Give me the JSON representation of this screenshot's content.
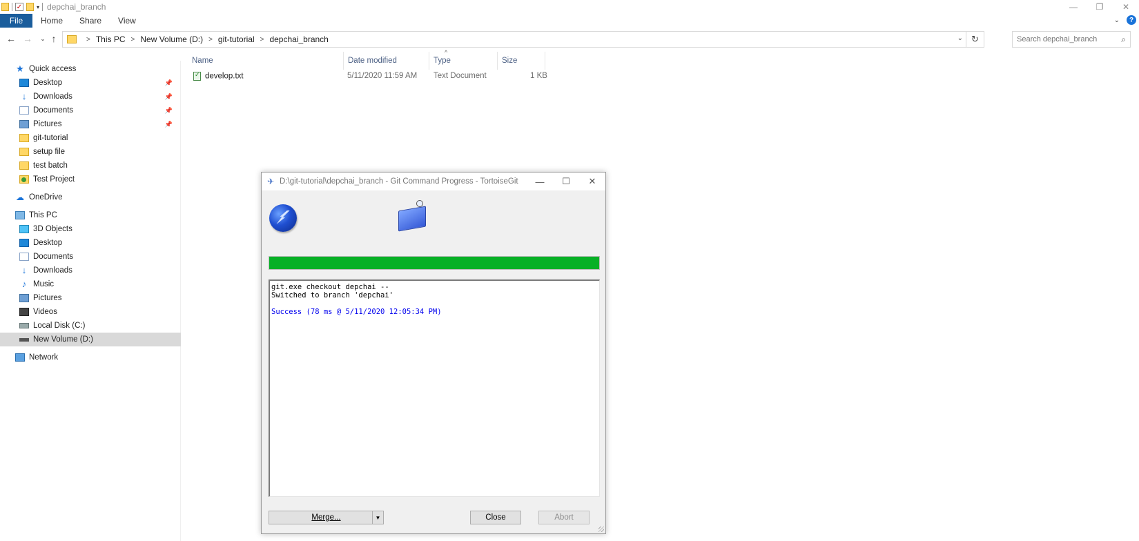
{
  "window": {
    "title": "depchai_branch"
  },
  "ribbon": {
    "tabs": [
      "File",
      "Home",
      "Share",
      "View"
    ]
  },
  "address": {
    "crumbs": [
      "This PC",
      "New Volume (D:)",
      "git-tutorial",
      "depchai_branch"
    ]
  },
  "search": {
    "placeholder": "Search depchai_branch"
  },
  "sidebar": {
    "quick_access": "Quick access",
    "quick_items": [
      "Desktop",
      "Downloads",
      "Documents",
      "Pictures",
      "git-tutorial",
      "setup file",
      "test batch",
      "Test Project"
    ],
    "onedrive": "OneDrive",
    "this_pc": "This PC",
    "pc_items": [
      "3D Objects",
      "Desktop",
      "Documents",
      "Downloads",
      "Music",
      "Pictures",
      "Videos",
      "Local Disk (C:)",
      "New Volume (D:)"
    ],
    "network": "Network"
  },
  "filelist": {
    "columns": [
      "Name",
      "Date modified",
      "Type",
      "Size"
    ],
    "rows": [
      {
        "name": "develop.txt",
        "date": "5/11/2020 11:59 AM",
        "type": "Text Document",
        "size": "1 KB"
      }
    ]
  },
  "dialog": {
    "title": "D:\\git-tutorial\\depchai_branch - Git Command Progress - TortoiseGit",
    "progress": 1.0,
    "log_lines": [
      "git.exe checkout depchai --",
      "Switched to branch 'depchai'",
      "",
      "Success (78 ms @ 5/11/2020 12:05:34 PM)"
    ],
    "merge_label": "Merge...",
    "close_label": "Close",
    "abort_label": "Abort"
  },
  "colors": {
    "progress_fill": "#06b025",
    "success_text": "#0000ee",
    "file_tab": "#1a5d9c"
  }
}
